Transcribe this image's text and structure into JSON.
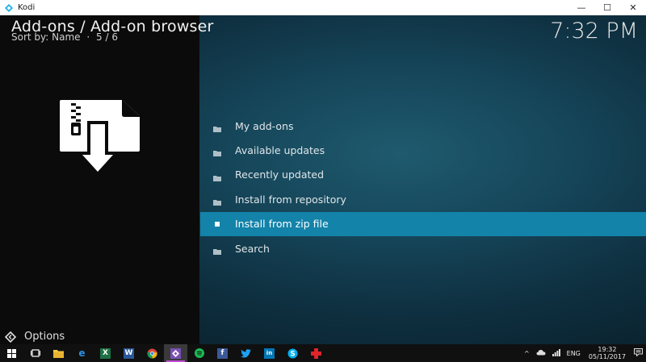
{
  "window": {
    "title": "Kodi",
    "controls": [
      "minimize-icon",
      "maximize-icon",
      "close-icon"
    ],
    "minimize_glyph": "—",
    "maximize_glyph": "☐",
    "close_glyph": "✕"
  },
  "header": {
    "title": "Add-ons / Add-on browser",
    "sort_label": "Sort by: Name",
    "separator": "·",
    "position": "5 / 6",
    "clock": "7:32 PM"
  },
  "preview_icon": "zip-install-icon",
  "menu": {
    "items": [
      {
        "label": "My add-ons",
        "icon": "folder-icon",
        "selected": false
      },
      {
        "label": "Available updates",
        "icon": "folder-icon",
        "selected": false
      },
      {
        "label": "Recently updated",
        "icon": "folder-icon",
        "selected": false
      },
      {
        "label": "Install from repository",
        "icon": "folder-icon",
        "selected": false
      },
      {
        "label": "Install from zip file",
        "icon": "square-bullet-icon",
        "selected": true
      },
      {
        "label": "Search",
        "icon": "folder-icon",
        "selected": false
      }
    ]
  },
  "options": {
    "label": "Options",
    "icon": "options-arrow-icon"
  },
  "taskbar": {
    "apps": [
      {
        "name": "start-icon",
        "active": false
      },
      {
        "name": "task-view-icon",
        "active": false
      },
      {
        "name": "file-explorer-icon",
        "active": false
      },
      {
        "name": "edge-icon",
        "active": false
      },
      {
        "name": "excel-icon",
        "active": false
      },
      {
        "name": "word-icon",
        "active": false
      },
      {
        "name": "chrome-icon",
        "active": false
      },
      {
        "name": "kodi-taskbar-icon",
        "active": true
      },
      {
        "name": "spotify-icon",
        "active": false
      },
      {
        "name": "facebook-icon",
        "active": false
      },
      {
        "name": "twitter-icon",
        "active": false
      },
      {
        "name": "linkedin-icon",
        "active": false
      },
      {
        "name": "skype-icon",
        "active": false
      },
      {
        "name": "red-app-icon",
        "active": false
      }
    ],
    "tray": {
      "chevron": "^",
      "language": "ENG",
      "time": "19:32",
      "date": "05/11/2017"
    }
  },
  "colors": {
    "selected_row": "#1383a9",
    "left_panel": "#0b0b0b",
    "taskbar": "#101010",
    "active_app_accent": "#c04ad0"
  }
}
